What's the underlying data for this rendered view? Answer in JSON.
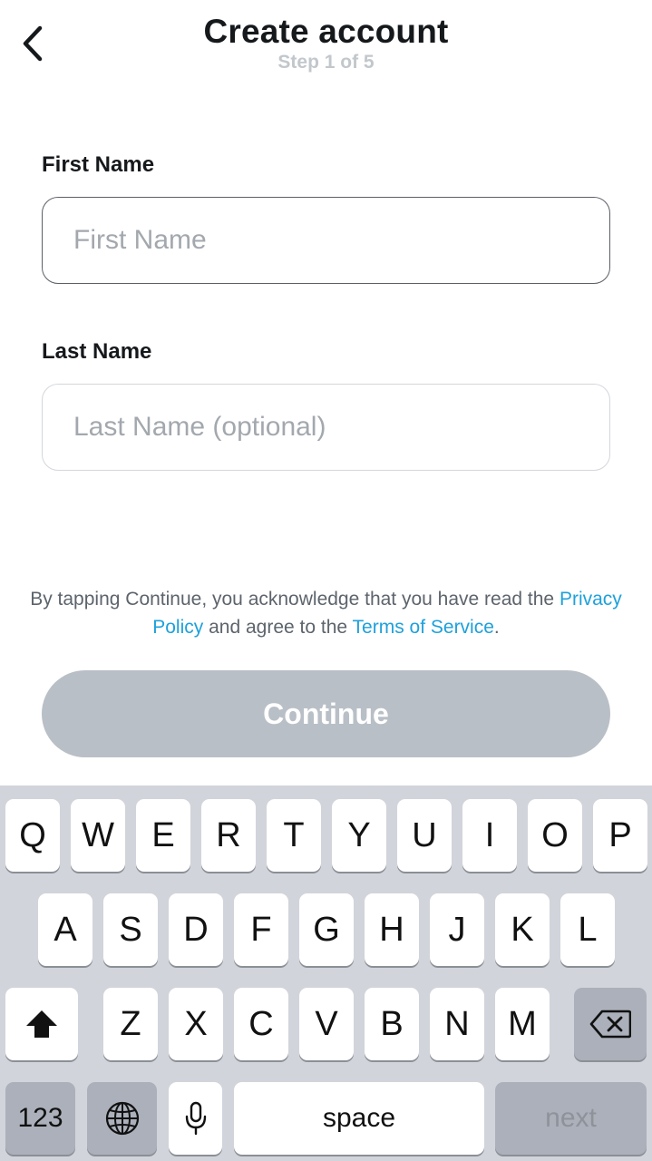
{
  "header": {
    "back_icon": "chevron-left-icon",
    "title": "Create account",
    "step": "Step 1 of 5"
  },
  "form": {
    "first_name": {
      "label": "First Name",
      "placeholder": "First Name",
      "value": ""
    },
    "last_name": {
      "label": "Last Name",
      "placeholder": "Last Name (optional)",
      "value": ""
    }
  },
  "legal": {
    "line_prefix": "By tapping Continue, you acknowledge that you have read the ",
    "privacy_link": "Privacy Policy",
    "middle": " and agree to the ",
    "terms_link": "Terms of Service",
    "suffix": "."
  },
  "continue_button": {
    "label": "Continue",
    "enabled": false
  },
  "colors": {
    "link": "#1ea1db",
    "button_disabled": "#b9bfc6",
    "keyboard_bg": "#d1d4da"
  },
  "keyboard": {
    "row1": [
      "Q",
      "W",
      "E",
      "R",
      "T",
      "Y",
      "U",
      "I",
      "O",
      "P"
    ],
    "row2": [
      "A",
      "S",
      "D",
      "F",
      "G",
      "H",
      "J",
      "K",
      "L"
    ],
    "row3": [
      "Z",
      "X",
      "C",
      "V",
      "B",
      "N",
      "M"
    ],
    "shift_icon": "shift-arrow-icon",
    "delete_icon": "backspace-icon",
    "numbers_key": "123",
    "globe_icon": "globe-icon",
    "mic_icon": "microphone-icon",
    "space_key": "space",
    "next_key": "next"
  }
}
